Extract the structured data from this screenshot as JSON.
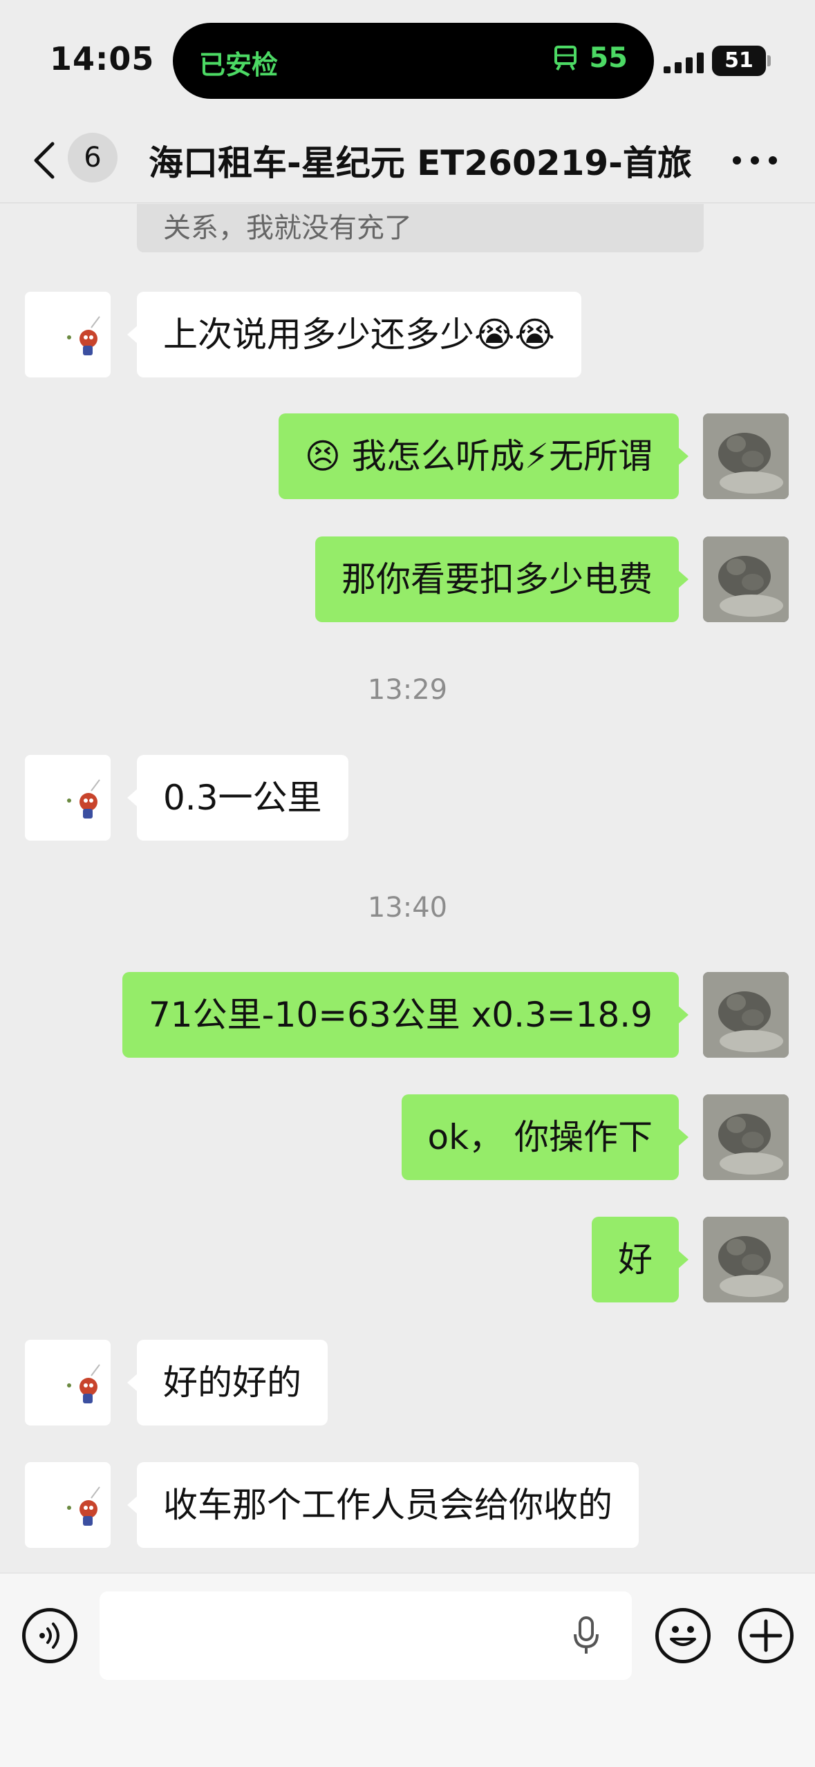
{
  "status_bar": {
    "time": "14:05",
    "island_left_text": "已安检",
    "island_right_text": "55",
    "battery": "51",
    "accent_color": "#4cd964"
  },
  "nav": {
    "back_icon": "chevron-left-icon",
    "unread_count": "6",
    "title": "海口租车-星纪元 ET260219-首旅",
    "more_icon": "more-dots-icon"
  },
  "messages": {
    "quoted_partial": "关系，我就没有充了",
    "m1": "上次说用多少还多少😭😭",
    "m2": "😣 我怎么听成⚡无所谓",
    "m3": "那你看要扣多少电费",
    "ts1": "13:29",
    "m4": "0.3一公里",
    "ts2": "13:40",
    "m5": "71公里-10=63公里 x0.3=18.9",
    "m6": "ok， 你操作下",
    "m7": "好",
    "m8": "好的好的",
    "m9": "收车那个工作人员会给你收的"
  },
  "colors": {
    "outgoing_bubble": "#95ec69",
    "incoming_bubble": "#ffffff",
    "background": "#ededed"
  },
  "input_bar": {
    "voice_icon": "voice-toggle-icon",
    "mic_icon": "microphone-icon",
    "emoji_icon": "emoji-icon",
    "plus_icon": "plus-icon"
  }
}
